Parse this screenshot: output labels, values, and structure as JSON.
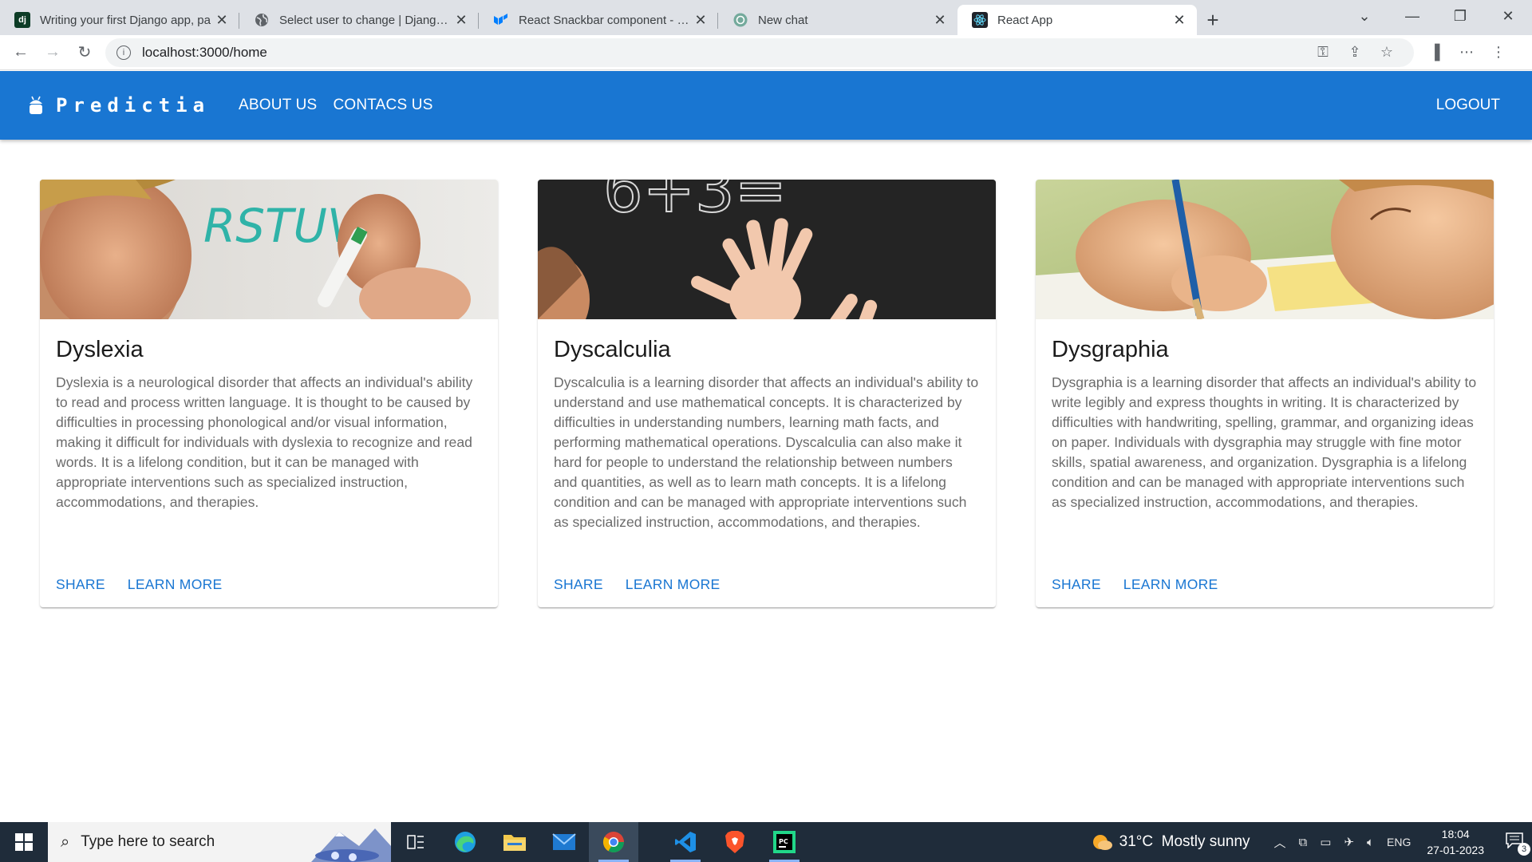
{
  "browser": {
    "tabs": [
      {
        "title": "Writing your first Django app, pa",
        "icon": "django-favicon",
        "active": false
      },
      {
        "title": "Select user to change | Django si",
        "icon": "globe-favicon",
        "active": false
      },
      {
        "title": "React Snackbar component - Ma",
        "icon": "mui-favicon",
        "active": false
      },
      {
        "title": "New chat",
        "icon": "openai-favicon",
        "active": false
      },
      {
        "title": "React App",
        "icon": "react-favicon",
        "active": true
      }
    ],
    "address": "localhost:3000/home"
  },
  "appbar": {
    "brand": "Predictia",
    "nav": [
      "ABOUT US",
      "CONTACS US"
    ],
    "logout": "LOGOUT",
    "color": "#1976d2"
  },
  "cards": [
    {
      "title": "Dyslexia",
      "description": "Dyslexia is a neurological disorder that affects an individual's ability to read and process written language. It is thought to be caused by difficulties in processing phonological and/or visual information, making it difficult for individuals with dyslexia to recognize and read words. It is a lifelong condition, but it can be managed with appropriate interventions such as specialized instruction, accommodations, and therapies.",
      "image_text": "RSTUVW",
      "share": "SHARE",
      "learn_more": "LEARN MORE"
    },
    {
      "title": "Dyscalculia",
      "description": "Dyscalculia is a learning disorder that affects an individual's ability to understand and use mathematical concepts. It is characterized by difficulties in understanding numbers, learning math facts, and performing mathematical operations. Dyscalculia can also make it hard for people to understand the relationship between numbers and quantities, as well as to learn math concepts. It is a lifelong condition and can be managed with appropriate interventions such as specialized instruction, accommodations, and therapies.",
      "image_text": "6+3=",
      "share": "SHARE",
      "learn_more": "LEARN MORE"
    },
    {
      "title": "Dysgraphia",
      "description": "Dysgraphia is a learning disorder that affects an individual's ability to write legibly and express thoughts in writing. It is characterized by difficulties with handwriting, spelling, grammar, and organizing ideas on paper. Individuals with dysgraphia may struggle with fine motor skills, spatial awareness, and organization. Dysgraphia is a lifelong condition and can be managed with appropriate interventions such as specialized instruction, accommodations, and therapies.",
      "share": "SHARE",
      "learn_more": "LEARN MORE"
    }
  ],
  "taskbar": {
    "search_placeholder": "Type here to search",
    "weather": "31°C  Mostly sunny",
    "language": "ENG",
    "time": "18:04",
    "date": "27-01-2023",
    "notifications": "3"
  }
}
